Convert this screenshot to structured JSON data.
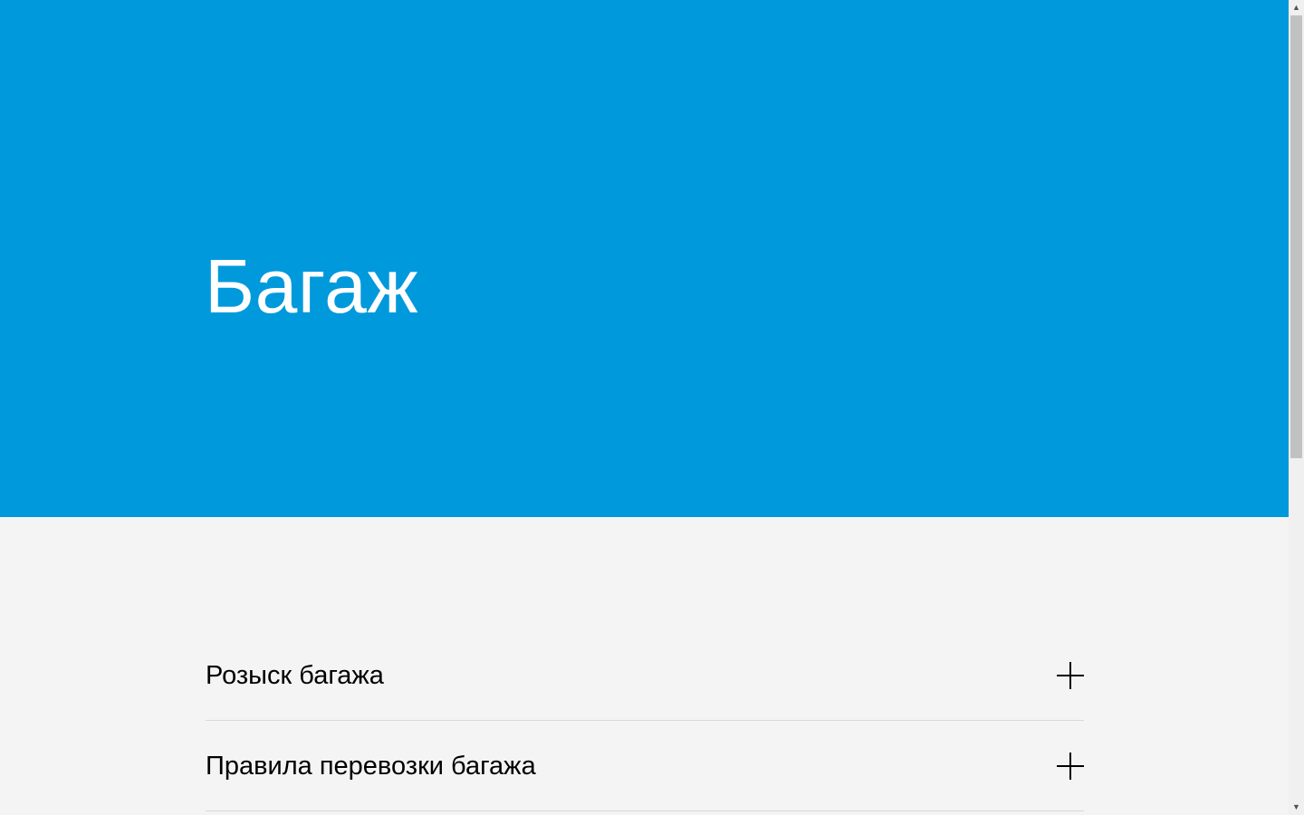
{
  "hero": {
    "title": "Багаж",
    "background_color": "#0099dc"
  },
  "accordion": {
    "items": [
      {
        "label": "Розыск багажа",
        "icon": "plus-icon",
        "expanded": false
      },
      {
        "label": "Правила перевозки багажа",
        "icon": "plus-icon",
        "expanded": false
      }
    ]
  },
  "scrollbar": {
    "up_icon": "▲",
    "down_icon": "▼"
  }
}
